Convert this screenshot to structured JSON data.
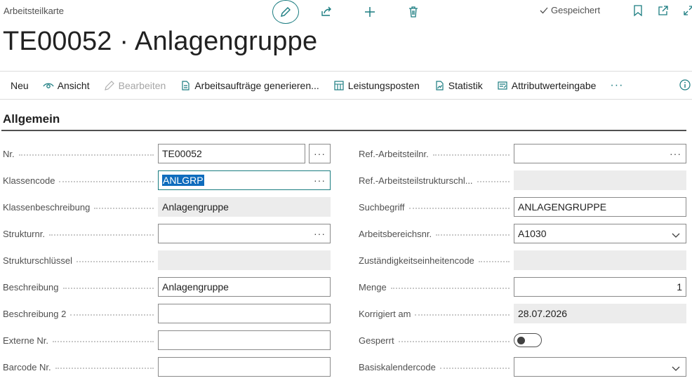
{
  "page": {
    "caption": "Arbeitsteilkarte",
    "title": "TE00052 · Anlagengruppe",
    "saved_label": "Gespeichert"
  },
  "colors": {
    "accent": "#1a7c80",
    "selection": "#0f6cbd",
    "readonly_bg": "#ececec"
  },
  "top_icons": [
    "edit-icon",
    "share-icon",
    "add-icon",
    "delete-icon"
  ],
  "header_icons": [
    "check-icon",
    "bookmark-icon",
    "open-new-window-icon",
    "expand-icon"
  ],
  "actions": {
    "neu": "Neu",
    "ansicht": "Ansicht",
    "bearbeiten": "Bearbeiten",
    "generieren": "Arbeitsaufträge generieren...",
    "leistungsposten": "Leistungsposten",
    "statistik": "Statistik",
    "attribut": "Attributwerteingabe",
    "more": "···"
  },
  "section": {
    "title": "Allgemein"
  },
  "left_fields": [
    {
      "label": "Nr.",
      "value": "TE00052"
    },
    {
      "label": "Klassencode",
      "value": "ANLGRP"
    },
    {
      "label": "Klassenbeschreibung",
      "value": "Anlagengruppe"
    },
    {
      "label": "Strukturnr.",
      "value": ""
    },
    {
      "label": "Strukturschlüssel",
      "value": ""
    },
    {
      "label": "Beschreibung",
      "value": "Anlagengruppe"
    },
    {
      "label": "Beschreibung 2",
      "value": ""
    },
    {
      "label": "Externe Nr.",
      "value": ""
    },
    {
      "label": "Barcode Nr.",
      "value": ""
    }
  ],
  "right_fields": [
    {
      "label": "Ref.-Arbeitsteilnr.",
      "value": ""
    },
    {
      "label": "Ref.-Arbeitsteilstrukturschl...",
      "value": ""
    },
    {
      "label": "Suchbegriff",
      "value": "ANLAGENGRUPPE"
    },
    {
      "label": "Arbeitsbereichsnr.",
      "value": "A1030"
    },
    {
      "label": "Zuständigkeitseinheitencode",
      "value": ""
    },
    {
      "label": "Menge",
      "value": "1"
    },
    {
      "label": "Korrigiert am",
      "value": "28.07.2026"
    },
    {
      "label": "Gesperrt",
      "value": false
    },
    {
      "label": "Basiskalendercode",
      "value": ""
    }
  ],
  "ellipsis": "···"
}
